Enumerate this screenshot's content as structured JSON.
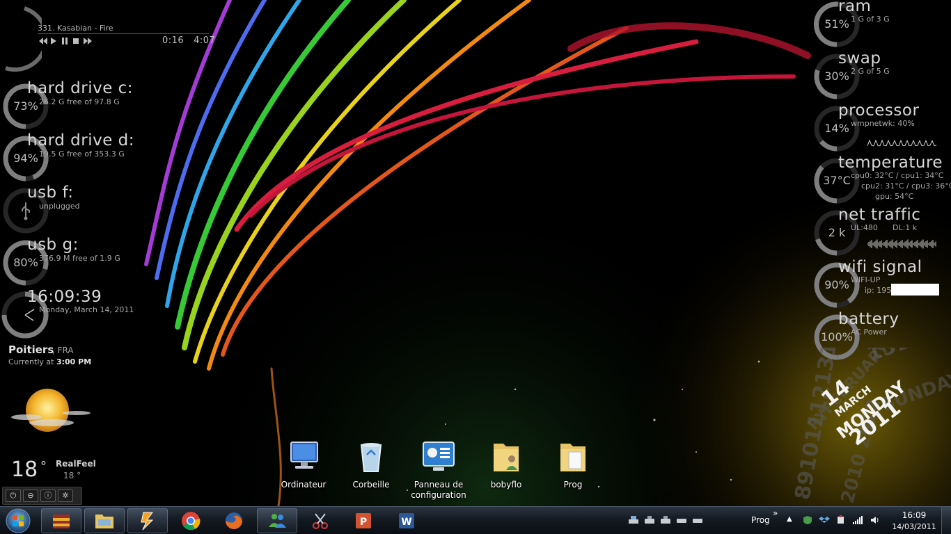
{
  "media_player": {
    "track": "331. Kasabian - Fire",
    "elapsed": "0:16",
    "duration": "4:07",
    "controls": [
      "previous",
      "play",
      "pause",
      "stop",
      "next"
    ]
  },
  "left_gauges": [
    {
      "key": "hdd_c",
      "title": "hard drive c:",
      "percent_label": "73%",
      "percent": 73,
      "detail": "26.2 G free of 97.8 G"
    },
    {
      "key": "hdd_d",
      "title": "hard drive d:",
      "percent_label": "94%",
      "percent": 94,
      "detail": "19.5 G free of 353.3 G"
    },
    {
      "key": "usb_f",
      "title": "usb f:",
      "percent_label": "",
      "percent": 0,
      "detail": "unplugged",
      "icon": "usb-icon"
    },
    {
      "key": "usb_g",
      "title": "usb g:",
      "percent_label": "80%",
      "percent": 80,
      "detail": "376.9 M free of 1.9 G"
    }
  ],
  "clock": {
    "time": "16:09:39",
    "date": "Monday, March 14, 2011"
  },
  "weather": {
    "city": "Poitiers",
    "country": ", FRA",
    "currently_label": "Currently at",
    "currently_time": "3:00 PM",
    "temperature": "18",
    "degree_symbol": "°",
    "realfeel_label": "RealFeel",
    "realfeel_value": "18 °",
    "icon": "partly-sunny-icon"
  },
  "power_buttons": [
    {
      "name": "power-icon",
      "glyph": "⏻"
    },
    {
      "name": "minus-icon",
      "glyph": "⊖"
    },
    {
      "name": "info-icon",
      "glyph": "ⓘ"
    },
    {
      "name": "settings-icon",
      "glyph": "✲"
    }
  ],
  "right_gauges": {
    "ram": {
      "title": "ram",
      "percent_label": "51%",
      "percent": 51,
      "detail": "1 G of 3 G"
    },
    "swap": {
      "title": "swap",
      "percent_label": "30%",
      "percent": 30,
      "detail": "2 G of 5 G"
    },
    "processor": {
      "title": "processor",
      "percent_label": "14%",
      "percent": 14,
      "detail": "wmpnetwk: 40%"
    },
    "temperature": {
      "title": "temperature",
      "percent_label": "37°C",
      "percent": 37,
      "lines": [
        "cpu0: 32°C / cpu1: 34°C",
        "cpu2: 31°C / cpu3: 36°C",
        "gpu: 54°C"
      ]
    },
    "net": {
      "title": "net traffic",
      "percent_label": "2 k",
      "percent": 20,
      "ul": "UL:480",
      "dl": "DL:1 k"
    },
    "wifi": {
      "title": "wifi signal",
      "percent_label": "90%",
      "percent": 90,
      "status": "WIFI-UP",
      "ip_label": "ip: 195"
    },
    "battery": {
      "title": "battery",
      "percent_label": "100%",
      "percent": 100,
      "detail": "AC Power"
    }
  },
  "calendar_deco": {
    "day_number": "14",
    "month": "MARCH",
    "weekday": "MONDAY",
    "year": "2011",
    "days_row": "15161718192",
    "months_row": "RYFEBRUARYAPRILMAYJU",
    "weekdays_row": "SUNDAYTUESD",
    "years_row": "2010 2012",
    "days_row2": "891011121311"
  },
  "desktop_icons": [
    {
      "label": "Ordinateur",
      "icon": "computer-icon"
    },
    {
      "label": "Corbeille",
      "icon": "recycle-bin-icon"
    },
    {
      "label": "Panneau de configuration",
      "icon": "control-panel-icon"
    },
    {
      "label": "bobyflo",
      "icon": "user-folder-icon"
    },
    {
      "label": "Prog",
      "icon": "folder-icon"
    }
  ],
  "taskbar": {
    "apps": [
      {
        "name": "winrar-icon"
      },
      {
        "name": "explorer-icon"
      },
      {
        "name": "winamp-icon"
      },
      {
        "name": "chrome-icon"
      },
      {
        "name": "firefox-icon"
      },
      {
        "name": "messenger-icon"
      },
      {
        "name": "snipping-tool-icon"
      },
      {
        "name": "powerpoint-icon"
      },
      {
        "name": "word-icon"
      }
    ],
    "toolbar_label": "Prog",
    "chevron": "»",
    "show_hidden": "▲",
    "time": "16:09",
    "date": "14/03/2011"
  },
  "colors": {
    "gauge_track": "#262626",
    "gauge_fill": "#7e7e7e",
    "taskbar_top": "#2b3440",
    "taskbar_bottom": "#0a0e13"
  }
}
